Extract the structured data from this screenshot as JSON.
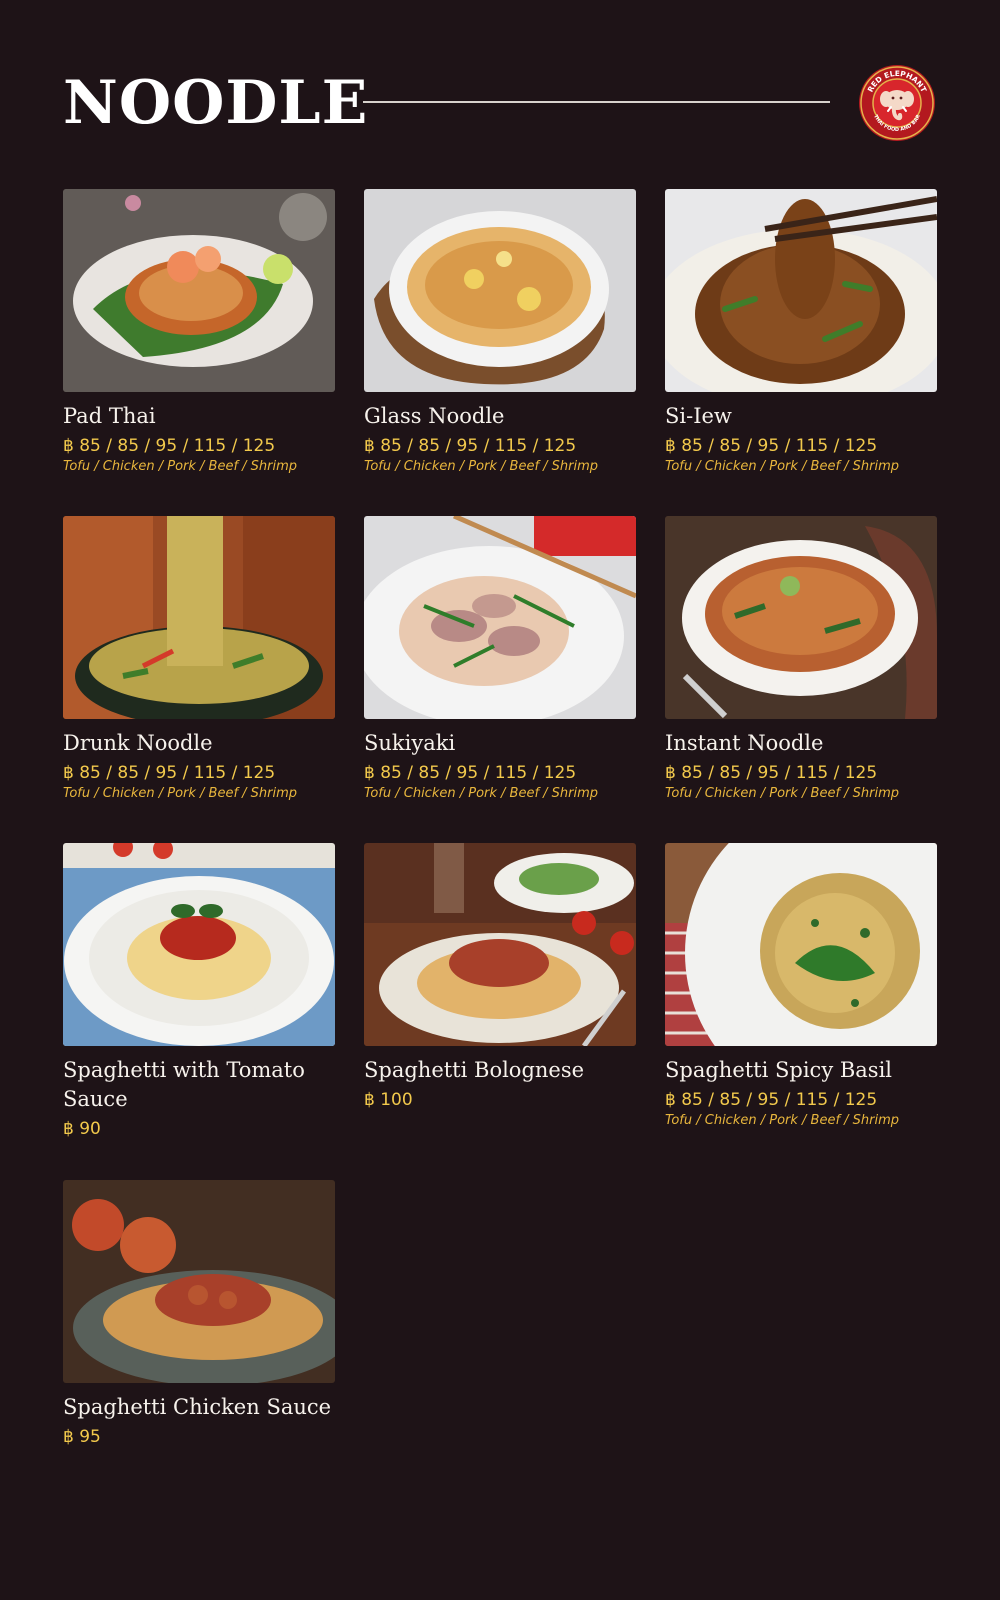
{
  "header": {
    "title": "NOODLE",
    "logo": {
      "top_text": "RED ELEPHANT",
      "bottom_text": "THAI FOOD AND BAR",
      "icon": "elephant-icon",
      "colors": {
        "ring": "#b3191f",
        "gold": "#e5b24a"
      }
    }
  },
  "colors": {
    "background": "#1e1317",
    "price": "#f2c94c",
    "text": "#f7f2ec"
  },
  "menu": {
    "items": [
      {
        "name": "Pad Thai",
        "price": "฿ 85 / 85 / 95 / 115 / 125",
        "options": "Tofu / Chicken / Pork / Beef / Shrimp"
      },
      {
        "name": "Glass Noodle",
        "price": "฿ 85 / 85 / 95 / 115 / 125",
        "options": "Tofu / Chicken / Pork / Beef / Shrimp"
      },
      {
        "name": "Si-Iew",
        "price": "฿ 85 / 85 / 95 / 115 / 125",
        "options": "Tofu / Chicken / Pork / Beef / Shrimp"
      },
      {
        "name": "Drunk Noodle",
        "price": "฿ 85 / 85 / 95 / 115 / 125",
        "options": "Tofu / Chicken / Pork / Beef / Shrimp"
      },
      {
        "name": "Sukiyaki",
        "price": "฿ 85 / 85 / 95 / 115 / 125",
        "options": "Tofu / Chicken / Pork / Beef / Shrimp"
      },
      {
        "name": "Instant Noodle",
        "price": "฿ 85 / 85 / 95 / 115 / 125",
        "options": "Tofu / Chicken / Pork / Beef / Shrimp"
      },
      {
        "name": "Spaghetti with Tomato Sauce",
        "price": "฿ 90"
      },
      {
        "name": "Spaghetti Bolognese",
        "price": "฿ 100"
      },
      {
        "name": "Spaghetti Spicy Basil",
        "price": "฿ 85 / 85 / 95 / 115 / 125",
        "options": "Tofu / Chicken / Pork / Beef / Shrimp"
      },
      {
        "name": "Spaghetti Chicken Sauce",
        "price": "฿ 95"
      }
    ]
  }
}
